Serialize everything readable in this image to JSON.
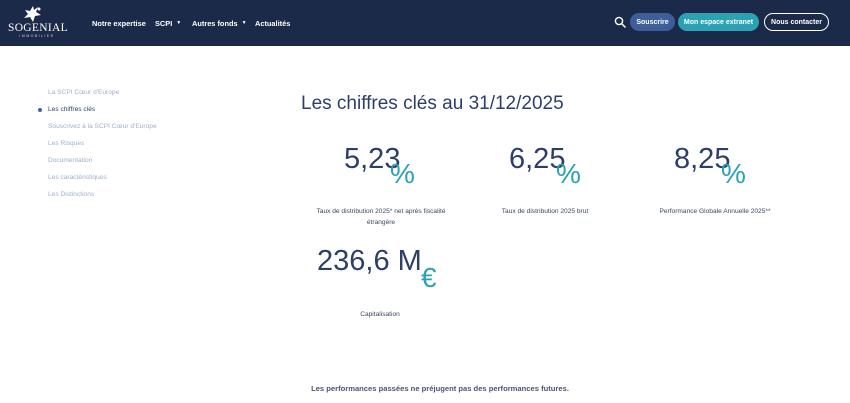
{
  "header": {
    "logo": {
      "name": "SOGENIAL",
      "sub": "IMMOBILIER"
    },
    "nav": [
      {
        "label": "Notre expertise",
        "has_dropdown": false
      },
      {
        "label": "SCPI",
        "has_dropdown": true
      },
      {
        "label": "Autres fonds",
        "has_dropdown": true
      },
      {
        "label": "Actualités",
        "has_dropdown": false
      }
    ],
    "search_icon": "search-icon",
    "subscribe_label": "Souscrire",
    "extranet_label": "Mon espace extranet",
    "contact_label": "Nous contacter"
  },
  "sidebar": {
    "items": [
      {
        "label": "La SCPI Cœur d'Europe",
        "active": false
      },
      {
        "label": "Les chiffres clés",
        "active": true
      },
      {
        "label": "Souscrivez à la SCPI Cœur d'Europe",
        "active": false
      },
      {
        "label": "Les Risques",
        "active": false
      },
      {
        "label": "Documentation",
        "active": false
      },
      {
        "label": "Les caractéristiques",
        "active": false
      },
      {
        "label": "Les Distinctions",
        "active": false
      }
    ]
  },
  "main": {
    "title": "Les chiffres clés au 31/12/2025",
    "kpis": [
      {
        "value": "5,23",
        "unit": "%",
        "label_line1": "Taux de distribution 2025* net après fiscalité",
        "label_line2": "étrangère"
      },
      {
        "value": "6,25",
        "unit": "%",
        "label_line1": "Taux de distribution 2025 brut",
        "label_line2": ""
      },
      {
        "value": "8,25",
        "unit": "%",
        "label_line1": "Performance Globale Annuelle 2025**",
        "label_line2": ""
      },
      {
        "value": "236,6 M",
        "unit": "€",
        "label_line1": "Capitalisation",
        "label_line2": ""
      }
    ],
    "footer_note": "Les performances passées ne préjugent pas des performances futures."
  },
  "colors": {
    "header_bg": "#1c2a4a",
    "primary_text": "#2c3f6b",
    "accent_teal": "#2aa2b4",
    "button_blue": "#3e5e9a",
    "sidebar_text": "#9fb0c9"
  }
}
